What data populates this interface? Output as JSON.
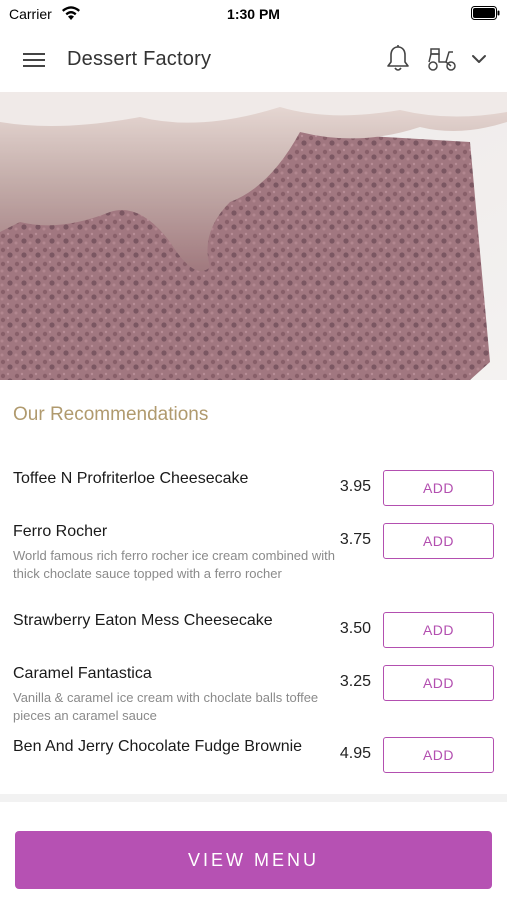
{
  "status_bar": {
    "carrier": "Carrier",
    "time": "1:30 PM"
  },
  "header": {
    "title": "Dessert Factory",
    "icons": [
      "menu-icon",
      "bell-icon",
      "scooter-icon",
      "chevron-down-icon"
    ]
  },
  "hero": {
    "subject": "chocolate-cake-image"
  },
  "section": {
    "title": "Our Recommendations"
  },
  "items": [
    {
      "name": "Toffee N Profriterloe Cheesecake",
      "description": "",
      "price": "3.95",
      "button": "ADD"
    },
    {
      "name": "Ferro Rocher",
      "description": "World famous rich ferro rocher ice cream combined with thick choclate sauce topped with a ferro rocher",
      "price": "3.75",
      "button": "ADD"
    },
    {
      "name": "Strawberry Eaton Mess Cheesecake",
      "description": "",
      "price": "3.50",
      "button": "ADD"
    },
    {
      "name": "Caramel Fantastica",
      "description": "Vanilla & caramel ice cream with choclate balls toffee pieces an caramel sauce",
      "price": "3.25",
      "button": "ADD"
    },
    {
      "name": "Ben And Jerry Chocolate Fudge Brownie",
      "description": "",
      "price": "4.95",
      "button": "ADD"
    }
  ],
  "footer": {
    "button": "VIEW MENU"
  },
  "colors": {
    "accent": "#b651b3",
    "section_title": "#b09a6e",
    "description": "#8a8a8a"
  }
}
